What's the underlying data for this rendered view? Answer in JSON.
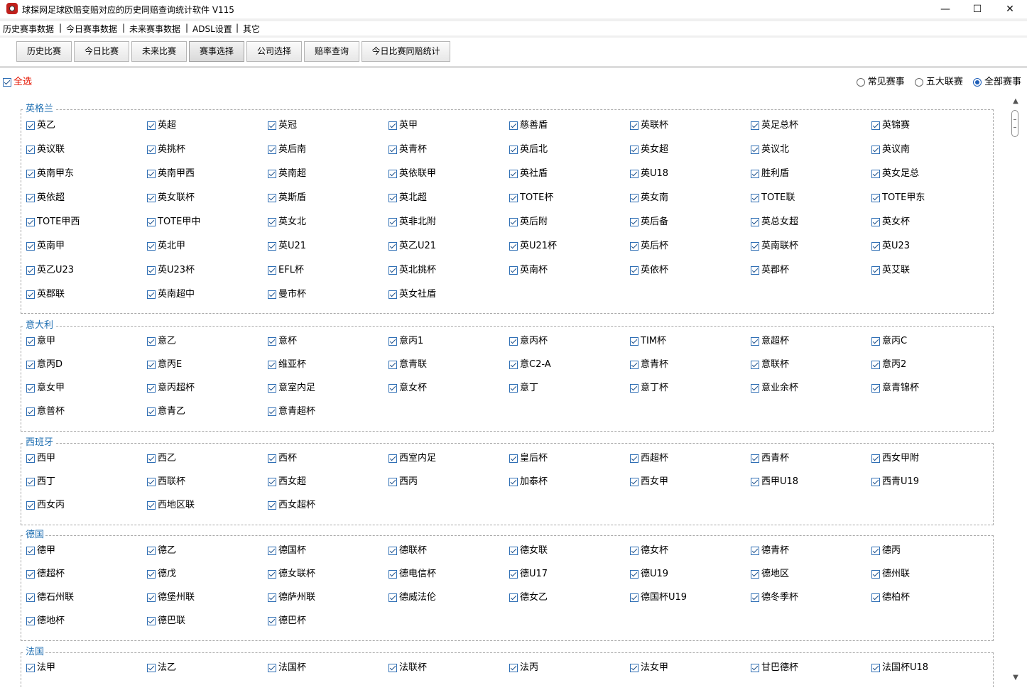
{
  "window": {
    "title": "球探网足球欧赔变赔对应的历史同赔查询统计软件 V115",
    "controls": {
      "minimize": "—",
      "maximize": "☐",
      "close": "✕"
    }
  },
  "menu": [
    "历史赛事数据",
    "今日赛事数据",
    "未来赛事数据",
    "ADSL设置",
    "其它"
  ],
  "menu_separator": "|",
  "toolbar": [
    "历史比赛",
    "今日比赛",
    "未来比赛",
    "赛事选择",
    "公司选择",
    "赔率查询",
    "今日比赛同赔统计"
  ],
  "select_all": {
    "label": "全选",
    "checked": true
  },
  "scope_radios": [
    {
      "label": "常见赛事",
      "selected": false
    },
    {
      "label": "五大联赛",
      "selected": false
    },
    {
      "label": "全部赛事",
      "selected": true
    }
  ],
  "groups": [
    {
      "name": "英格兰",
      "items": [
        "英乙",
        "英超",
        "英冠",
        "英甲",
        "慈善盾",
        "英联杯",
        "英足总杯",
        "英锦赛",
        "英议联",
        "英挑杯",
        "英后南",
        "英青杯",
        "英后北",
        "英女超",
        "英议北",
        "英议南",
        "英南甲东",
        "英南甲西",
        "英南超",
        "英依联甲",
        "英社盾",
        "英U18",
        "胜利盾",
        "英女足总",
        "英依超",
        "英女联杯",
        "英斯盾",
        "英北超",
        "TOTE杯",
        "英女南",
        "TOTE联",
        "TOTE甲东",
        "TOTE甲西",
        "TOTE甲中",
        "英女北",
        "英非北附",
        "英后附",
        "英后备",
        "英总女超",
        "英女杯",
        "英南甲",
        "英北甲",
        "英U21",
        "英乙U21",
        "英U21杯",
        "英后杯",
        "英南联杯",
        "英U23",
        "英乙U23",
        "英U23杯",
        "EFL杯",
        "英北挑杯",
        "英南杯",
        "英依杯",
        "英郡杯",
        "英艾联",
        "英郡联",
        "英南超中",
        "曼市杯",
        "英女社盾"
      ]
    },
    {
      "name": "意大利",
      "items": [
        "意甲",
        "意乙",
        "意杯",
        "意丙1",
        "意丙杯",
        "TIM杯",
        "意超杯",
        "意丙C",
        "意丙D",
        "意丙E",
        "维亚杯",
        "意青联",
        "意C2-A",
        "意青杯",
        "意联杯",
        "意丙2",
        "意女甲",
        "意丙超杯",
        "意室内足",
        "意女杯",
        "意丁",
        "意丁杯",
        "意业余杯",
        "意青锦杯",
        "意普杯",
        "意青乙",
        "意青超杯"
      ]
    },
    {
      "name": "西班牙",
      "items": [
        "西甲",
        "西乙",
        "西杯",
        "西室内足",
        "皇后杯",
        "西超杯",
        "西青杯",
        "西女甲附",
        "西丁",
        "西联杯",
        "西女超",
        "西丙",
        "加泰杯",
        "西女甲",
        "西甲U18",
        "西青U19",
        "西女丙",
        "西地区联",
        "西女超杯"
      ]
    },
    {
      "name": "德国",
      "items": [
        "德甲",
        "德乙",
        "德国杯",
        "德联杯",
        "德女联",
        "德女杯",
        "德青杯",
        "德丙",
        "德超杯",
        "德戊",
        "德女联杯",
        "德电信杯",
        "德U17",
        "德U19",
        "德地区",
        "德州联",
        "德石州联",
        "德堡州联",
        "德萨州联",
        "德威法伦",
        "德女乙",
        "德国杯U19",
        "德冬季杯",
        "德柏杯",
        "德地杯",
        "德巴联",
        "德巴杯"
      ]
    },
    {
      "name": "法国",
      "items": [
        "法甲",
        "法乙",
        "法国杯",
        "法联杯",
        "法丙",
        "法女甲",
        "甘巴德杯",
        "法国杯U18"
      ]
    }
  ]
}
